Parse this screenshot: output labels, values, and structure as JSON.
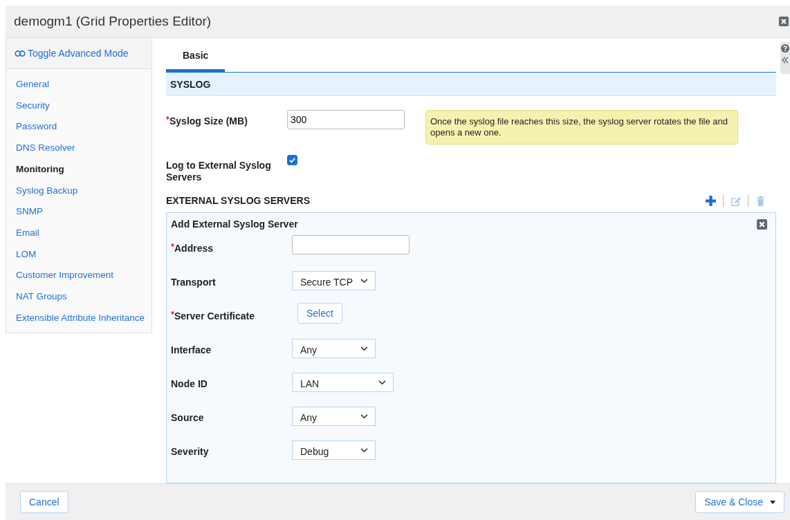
{
  "window": {
    "title": "demogm1 (Grid Properties Editor)"
  },
  "sidebar": {
    "toggle": "Toggle Advanced Mode",
    "items": [
      {
        "label": "General",
        "selected": false
      },
      {
        "label": "Security",
        "selected": false
      },
      {
        "label": "Password",
        "selected": false
      },
      {
        "label": "DNS Resolver",
        "selected": false
      },
      {
        "label": "Monitoring",
        "selected": true
      },
      {
        "label": "Syslog Backup",
        "selected": false
      },
      {
        "label": "SNMP",
        "selected": false
      },
      {
        "label": "Email",
        "selected": false
      },
      {
        "label": "LOM",
        "selected": false
      },
      {
        "label": "Customer Improvement",
        "selected": false
      },
      {
        "label": "NAT Groups",
        "selected": false
      },
      {
        "label": "Extensible Attribute Inheritance",
        "selected": false
      }
    ]
  },
  "tabs": [
    {
      "label": "Basic",
      "selected": true
    }
  ],
  "section": {
    "title": "SYSLOG"
  },
  "fields": [
    {
      "kind": "text",
      "label": "Syslog Size (MB)",
      "required": true,
      "value": "300",
      "hint": "Once the syslog file reaches this size, the syslog server rotates the file and opens a new one."
    },
    {
      "kind": "checkbox",
      "label": "Log to External Syslog Servers",
      "required": false,
      "checked": true
    }
  ],
  "servers": {
    "title": "EXTERNAL SYSLOG SERVERS",
    "toolbar": [
      {
        "kind": "add",
        "disabled": false
      },
      {
        "kind": "edit",
        "disabled": true
      },
      {
        "kind": "delete",
        "disabled": true
      }
    ],
    "panel": {
      "title": "Add External Syslog Server",
      "fields": [
        {
          "kind": "text",
          "label": "Address",
          "required": true
        },
        {
          "kind": "select",
          "label": "Transport",
          "required": false,
          "value": "Secure TCP"
        },
        {
          "kind": "button",
          "label": "Server Certificate",
          "required": true,
          "value": "Select"
        },
        {
          "kind": "select",
          "label": "Interface",
          "required": false,
          "value": "Any"
        },
        {
          "kind": "wideselect",
          "label": "Node ID",
          "required": false,
          "value": "LAN"
        },
        {
          "kind": "select",
          "label": "Source",
          "required": false,
          "value": "Any"
        },
        {
          "kind": "select",
          "label": "Severity",
          "required": false,
          "value": "Debug"
        }
      ]
    }
  },
  "footer": {
    "cancel": "Cancel",
    "save": "Save & Close"
  }
}
